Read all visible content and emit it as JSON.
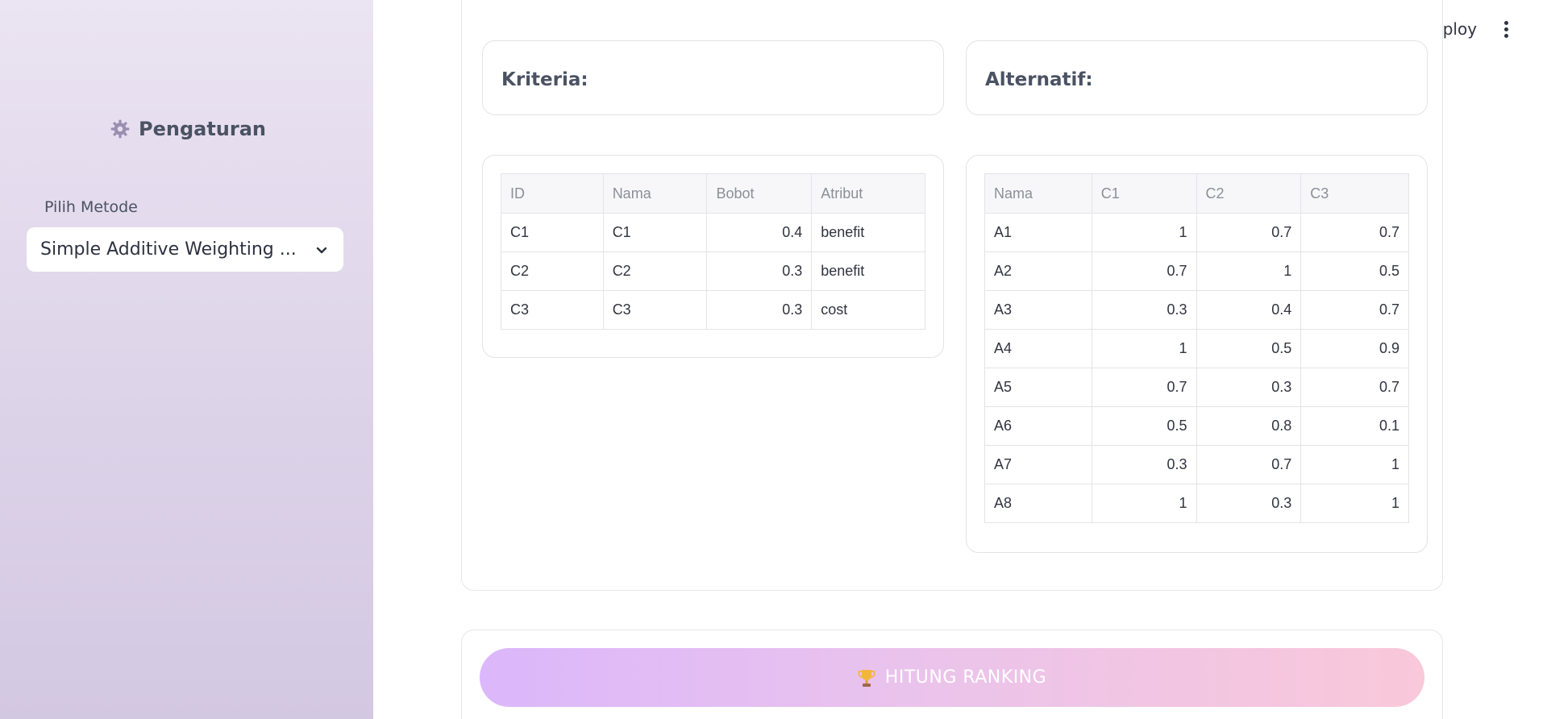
{
  "sidebar": {
    "title": "Pengaturan",
    "select_label": "Pilih Metode",
    "select_value": "Simple Additive Weighting ..."
  },
  "header": {
    "deploy_label": "Deploy"
  },
  "criteria": {
    "label": "Kriteria:",
    "headers": [
      "ID",
      "Nama",
      "Bobot",
      "Atribut"
    ],
    "rows": [
      [
        "C1",
        "C1",
        "0.4",
        "benefit"
      ],
      [
        "C2",
        "C2",
        "0.3",
        "benefit"
      ],
      [
        "C3",
        "C3",
        "0.3",
        "cost"
      ]
    ]
  },
  "alternatives": {
    "label": "Alternatif:",
    "headers": [
      "Nama",
      "C1",
      "C2",
      "C3"
    ],
    "rows": [
      [
        "A1",
        "1",
        "0.7",
        "0.7"
      ],
      [
        "A2",
        "0.7",
        "1",
        "0.5"
      ],
      [
        "A3",
        "0.3",
        "0.4",
        "0.7"
      ],
      [
        "A4",
        "1",
        "0.5",
        "0.9"
      ],
      [
        "A5",
        "0.7",
        "0.3",
        "0.7"
      ],
      [
        "A6",
        "0.5",
        "0.8",
        "0.1"
      ],
      [
        "A7",
        "0.3",
        "0.7",
        "1"
      ],
      [
        "A8",
        "1",
        "0.3",
        "1"
      ]
    ]
  },
  "action": {
    "button_label": "HITUNG RANKING"
  },
  "icons": {
    "title_icon": "gear-icon",
    "select_icon": "chevron-down-icon",
    "button_icon": "trophy-icon",
    "menu_icon": "kebab-menu-icon"
  },
  "colors": {
    "sidebar_top": "#ebe4f2",
    "sidebar_bottom": "#d3c8e2",
    "button_gradient_start": "#dbb7fb",
    "button_gradient_end": "#f9c8d9"
  }
}
